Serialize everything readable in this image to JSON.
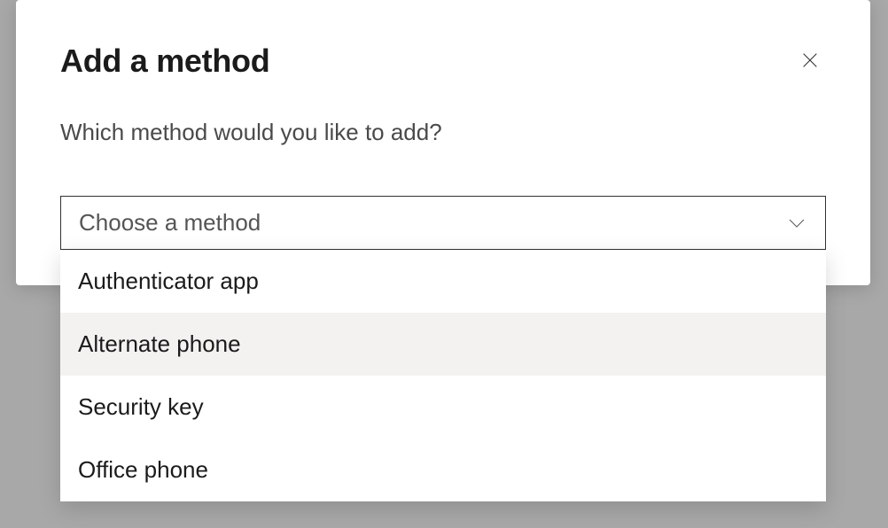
{
  "dialog": {
    "title": "Add a method",
    "subtitle": "Which method would you like to add?",
    "select": {
      "placeholder": "Choose a method",
      "options": [
        {
          "label": "Authenticator app",
          "hovered": false
        },
        {
          "label": "Alternate phone",
          "hovered": true
        },
        {
          "label": "Security key",
          "hovered": false
        },
        {
          "label": "Office phone",
          "hovered": false
        }
      ]
    }
  }
}
